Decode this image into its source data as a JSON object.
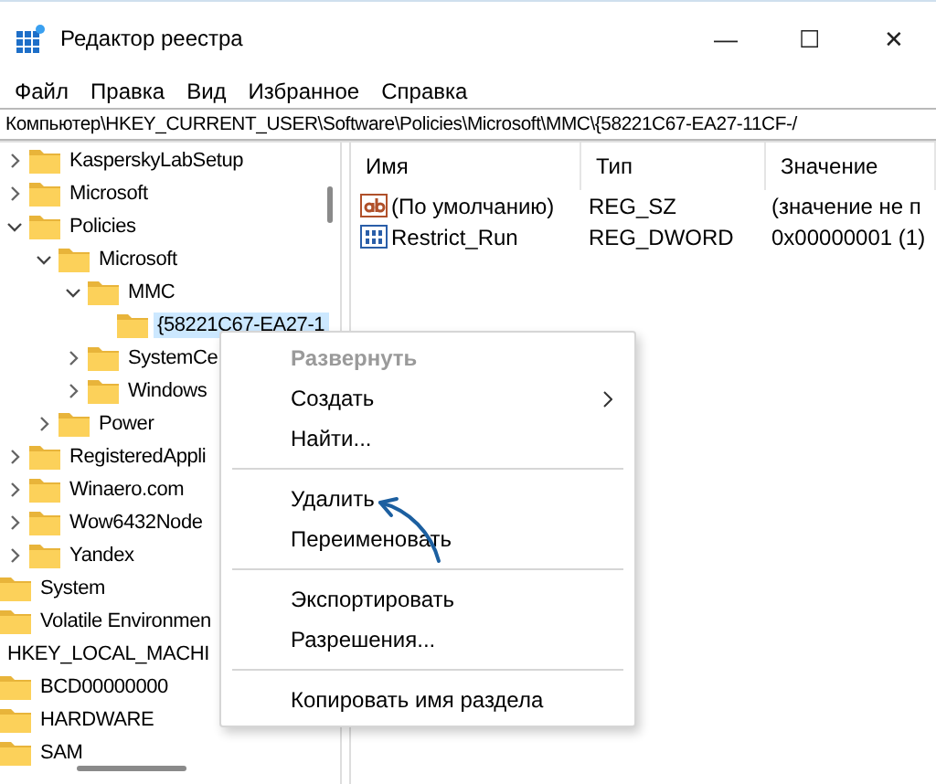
{
  "window": {
    "title": "Редактор реестра",
    "controls": [
      "—",
      "☐",
      "✕"
    ]
  },
  "menu": [
    "Файл",
    "Правка",
    "Вид",
    "Избранное",
    "Справка"
  ],
  "address": "Компьютер\\HKEY_CURRENT_USER\\Software\\Policies\\Microsoft\\MMC\\{58221C67-EA27-11CF-/",
  "tree": [
    {
      "children": [
        {
          "children": [
            {
              "label": "KasperskyLabSetup",
              "expanded": false,
              "selected": false
            },
            {
              "label": "Microsoft",
              "expanded": false,
              "selected": false
            },
            {
              "label": "Policies",
              "expanded": true,
              "selected": false,
              "children": [
                {
                  "label": "Microsoft",
                  "expanded": true,
                  "selected": false,
                  "children": [
                    {
                      "label": "MMC",
                      "expanded": true,
                      "selected": false,
                      "children": [
                        {
                          "label": "{58221C67-EA27-1",
                          "selected": true
                        }
                      ]
                    },
                    {
                      "label": "SystemCe",
                      "expanded": false,
                      "selected": false
                    },
                    {
                      "label": "Windows",
                      "expanded": false,
                      "selected": false
                    }
                  ]
                },
                {
                  "label": "Power",
                  "expanded": false,
                  "selected": false
                }
              ]
            },
            {
              "label": "RegisteredAppli",
              "expanded": false,
              "selected": false
            },
            {
              "label": "Winaero.com",
              "expanded": false,
              "selected": false
            },
            {
              "label": "Wow6432Node",
              "expanded": false,
              "selected": false
            },
            {
              "label": "Yandex",
              "expanded": false,
              "selected": false
            }
          ]
        },
        {
          "label": "System",
          "selected": false
        },
        {
          "label": "Volatile Environmen",
          "selected": false
        }
      ]
    },
    {
      "label": "HKEY_LOCAL_MACHI",
      "kind": "hive",
      "selected": false,
      "children": [
        {
          "label": "BCD00000000",
          "selected": false
        },
        {
          "label": "HARDWARE",
          "selected": false
        },
        {
          "label": "SAM",
          "selected": false
        }
      ]
    }
  ],
  "values": {
    "columns": [
      "Имя",
      "Тип",
      "Значение"
    ],
    "rows": [
      {
        "kind": "string",
        "name": "(По умолчанию)",
        "type": "REG_SZ",
        "data": "(значение не п"
      },
      {
        "kind": "number",
        "name": "Restrict_Run",
        "type": "REG_DWORD",
        "data": "0x00000001 (1)"
      }
    ]
  },
  "context_menu": [
    {
      "kind": "item",
      "label": "Развернуть",
      "disabled": true,
      "submenu": false
    },
    {
      "kind": "item",
      "label": "Создать",
      "disabled": false,
      "submenu": true
    },
    {
      "kind": "item",
      "label": "Найти...",
      "disabled": false,
      "submenu": false
    },
    {
      "kind": "separator"
    },
    {
      "kind": "item",
      "label": "Удалить",
      "disabled": false,
      "submenu": false
    },
    {
      "kind": "item",
      "label": "Переименовать",
      "disabled": false,
      "submenu": false
    },
    {
      "kind": "separator"
    },
    {
      "kind": "item",
      "label": "Экспортировать",
      "disabled": false,
      "submenu": false
    },
    {
      "kind": "item",
      "label": "Разрешения...",
      "disabled": false,
      "submenu": false
    },
    {
      "kind": "separator"
    },
    {
      "kind": "item",
      "label": "Копировать имя раздела",
      "disabled": false,
      "submenu": false
    }
  ]
}
